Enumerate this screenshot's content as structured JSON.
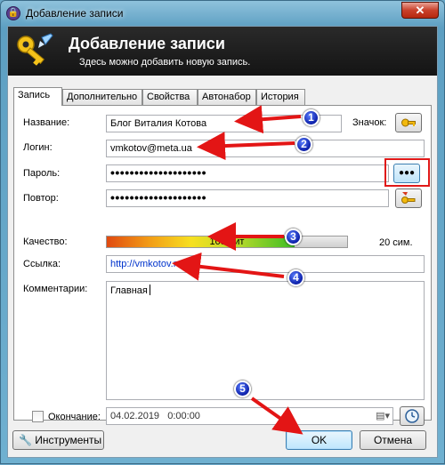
{
  "window": {
    "title": "Добавление записи",
    "close_label": "✕"
  },
  "banner": {
    "title": "Добавление записи",
    "subtitle": "Здесь можно добавить новую запись."
  },
  "tabs": [
    {
      "label": "Запись",
      "active": true
    },
    {
      "label": "Дополнительно"
    },
    {
      "label": "Свойства"
    },
    {
      "label": "Автонабор"
    },
    {
      "label": "История"
    }
  ],
  "form": {
    "title_label": "Название:",
    "title_value": "Блог Виталия Котова",
    "icon_label": "Значок:",
    "login_label": "Логин:",
    "login_value": "vmkotov@meta.ua",
    "password_label": "Пароль:",
    "password_value": "••••••••••••••••••••",
    "show_password_label": "●●●",
    "repeat_label": "Повтор:",
    "repeat_value": "••••••••••••••••••••",
    "quality_label": "Качество:",
    "quality_text": "105 бит",
    "quality_fraction": 0.78,
    "chars_text": "20 сим.",
    "url_label": "Ссылка:",
    "url_value": "http://vmkotov.ru/",
    "comments_label": "Комментарии:",
    "comments_value": "Главная",
    "expiry_label": "Окончание:",
    "expiry_value": "04.02.2019   0:00:00"
  },
  "buttons": {
    "tools": "Инструменты",
    "ok": "OK",
    "cancel": "Отмена"
  },
  "annotations": [
    "1",
    "2",
    "3",
    "4",
    "5"
  ]
}
